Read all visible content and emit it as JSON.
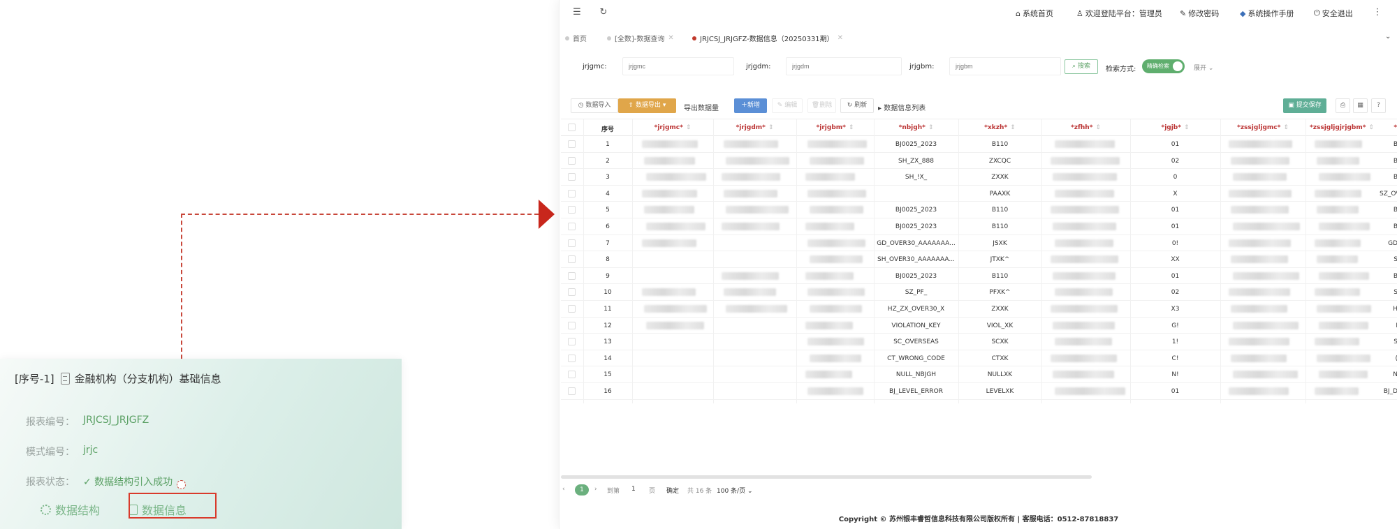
{
  "card": {
    "title_prefix": "[序号-1]",
    "title": "金融机构（分支机构）基础信息",
    "report_no_label": "报表编号：",
    "report_no": "JRJCSJ_JRJGFZ",
    "schema_no_label": "模式编号：",
    "schema_no": "jrjc",
    "status_label": "报表状态：",
    "status": "✓ 数据结构引入成功",
    "tab_structure": "数据结构",
    "tab_info": "数据信息"
  },
  "topbar": {
    "home": "系统首页",
    "welcome": "欢迎登陆平台：管理员",
    "change_pwd": "修改密码",
    "manual": "系统操作手册",
    "logout": "安全退出"
  },
  "tabs": [
    {
      "label": "首页"
    },
    {
      "label": "[全数]-数据查询"
    },
    {
      "label": "JRJCSJ_JRJGFZ-数据信息（20250331期）"
    }
  ],
  "search": {
    "f1_label": "jrjgmc:",
    "f1_placeholder": "jrjgmc",
    "f2_label": "jrjgdm:",
    "f2_placeholder": "jrjgdm",
    "f3_label": "jrjgbm:",
    "f3_placeholder": "jrjgbm",
    "search_btn": "搜索",
    "mode_label": "检索方式:",
    "mode_value": "精确检索",
    "expand": "展开"
  },
  "toolbar": {
    "import": "数据导入",
    "export": "数据导出",
    "export_count": "导出数据量",
    "add": "新增",
    "edit": "编辑",
    "delete": "删除",
    "refresh": "刷新",
    "list_title": "数据信息列表",
    "submit": "提交保存"
  },
  "table": {
    "columns": [
      "序号",
      "*jrjgmc*",
      "*jrjgdm*",
      "*jrjgbm*",
      "*nbjgh*",
      "*xkzh*",
      "*zfhh*",
      "*jgjb*",
      "*zssjgljgmc*",
      "*zssjgljgjrjgbm*",
      "*zs"
    ],
    "rows": [
      {
        "no": "1",
        "nbjgh": "BJ0025_2023",
        "xkzh": "B110",
        "jgjb": "01",
        "last": "B"
      },
      {
        "no": "2",
        "nbjgh": "SH_ZX_888",
        "xkzh": "ZXCQC",
        "jgjb": "02",
        "last": "B"
      },
      {
        "no": "3",
        "nbjgh": "SH_!X_",
        "xkzh": "ZXXK",
        "jgjb": "0",
        "last": "B"
      },
      {
        "no": "4",
        "nbjgh": "",
        "xkzh": "PAAXK",
        "jgjb": "X",
        "last": "SZ_OV"
      },
      {
        "no": "5",
        "nbjgh": "BJ0025_2023",
        "xkzh": "B110",
        "jgjb": "01",
        "last": "B"
      },
      {
        "no": "6",
        "nbjgh": "BJ0025_2023",
        "xkzh": "B110",
        "jgjb": "01",
        "last": "B"
      },
      {
        "no": "7",
        "nbjgh": "GD_OVER30_AAAAAAA...",
        "xkzh": "JSXK",
        "jgjb": "0!",
        "last": "GD"
      },
      {
        "no": "8",
        "nbjgh": "SH_OVER30_AAAAAAA...",
        "xkzh": "JTXK^",
        "jgjb": "XX",
        "last": "S"
      },
      {
        "no": "9",
        "nbjgh": "BJ0025_2023",
        "xkzh": "B110",
        "jgjb": "01",
        "last": "B"
      },
      {
        "no": "10",
        "nbjgh": "SZ_PF_",
        "xkzh": "PFXK^",
        "jgjb": "02",
        "last": "S"
      },
      {
        "no": "11",
        "nbjgh": "HZ_ZX_OVER30_X",
        "xkzh": "ZXXK",
        "jgjb": "X3",
        "last": "H"
      },
      {
        "no": "12",
        "nbjgh": "VIOLATION_KEY",
        "xkzh": "VIOL_XK",
        "jgjb": "G!",
        "last": "I"
      },
      {
        "no": "13",
        "nbjgh": "SC_OVERSEAS",
        "xkzh": "SCXK",
        "jgjb": "1!",
        "last": "S"
      },
      {
        "no": "14",
        "nbjgh": "CT_WRONG_CODE",
        "xkzh": "CTXK",
        "jgjb": "C!",
        "last": "("
      },
      {
        "no": "15",
        "nbjgh": "NULL_NBJGH",
        "xkzh": "NULLXK",
        "jgjb": "N!",
        "last": "N"
      },
      {
        "no": "16",
        "nbjgh": "BJ_LEVEL_ERROR",
        "xkzh": "LEVELXK",
        "jgjb": "01",
        "last": "BJ_D"
      }
    ]
  },
  "pager": {
    "page": "1",
    "goto": "到第",
    "goto_val": "1",
    "page_unit": "页",
    "confirm": "确定",
    "total": "共 16 条",
    "per_page": "100 条/页"
  },
  "footer": "Copyright © 苏州银丰睿哲信息科技有限公司版权所有 | 客服电话：0512-87818837"
}
